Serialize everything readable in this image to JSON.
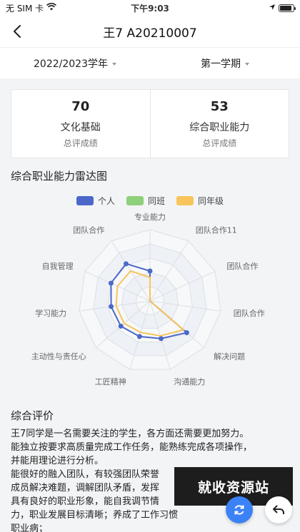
{
  "status_bar": {
    "carrier": "无 SIM 卡",
    "time": "下午9:03",
    "battery_level": 0.9
  },
  "nav": {
    "title": "王7 A20210007",
    "back_icon": "chevron-left-icon"
  },
  "filters": {
    "year": "2022/2023学年",
    "term": "第一学期"
  },
  "summary": [
    {
      "score": "70",
      "name": "文化基础",
      "sub": "总评成绩"
    },
    {
      "score": "53",
      "name": "综合职业能力",
      "sub": "总评成绩"
    }
  ],
  "radar_title": "综合职业能力雷达图",
  "chart_data": {
    "type": "radar",
    "axes": [
      "专业能力",
      "团队合作11",
      "团队合作",
      "团队合作",
      "解决问题",
      "沟通能力",
      "工匠精神",
      "主动性与责任心",
      "学习能力",
      "自我管理",
      "团队合作"
    ],
    "max": 100,
    "series": [
      {
        "name": "个人",
        "color": "#4b68c9",
        "values": [
          42,
          0,
          0,
          0,
          68,
          55,
          52,
          54,
          55,
          60,
          62
        ]
      },
      {
        "name": "同班",
        "color": "#8fd07a",
        "values": []
      },
      {
        "name": "同年级",
        "color": "#f7c55a",
        "values": [
          33,
          0,
          0,
          0,
          62,
          51,
          46,
          48,
          48,
          50,
          50
        ]
      }
    ],
    "rings": 5
  },
  "evaluation": {
    "title": "综合评价",
    "lines": [
      "王7同学是一名需要关注的学生，各方面还需要更加努力。",
      "能独立按要求高质量完成工作任务，能熟练完成各项操作，",
      "并能用理论进行分析。",
      "能很好的融入团队，有较强团队荣誉",
      "成员解决难题，调解团队矛盾，发挥",
      "具有良好的职业形象，能自我调节情",
      "力，职业发展目标清晰；养成了工作习惯",
      "职业病；"
    ]
  },
  "watermark": "就收资源站",
  "fab": {
    "refresh_icon": "refresh-icon",
    "back_icon": "return-arrow-icon"
  }
}
